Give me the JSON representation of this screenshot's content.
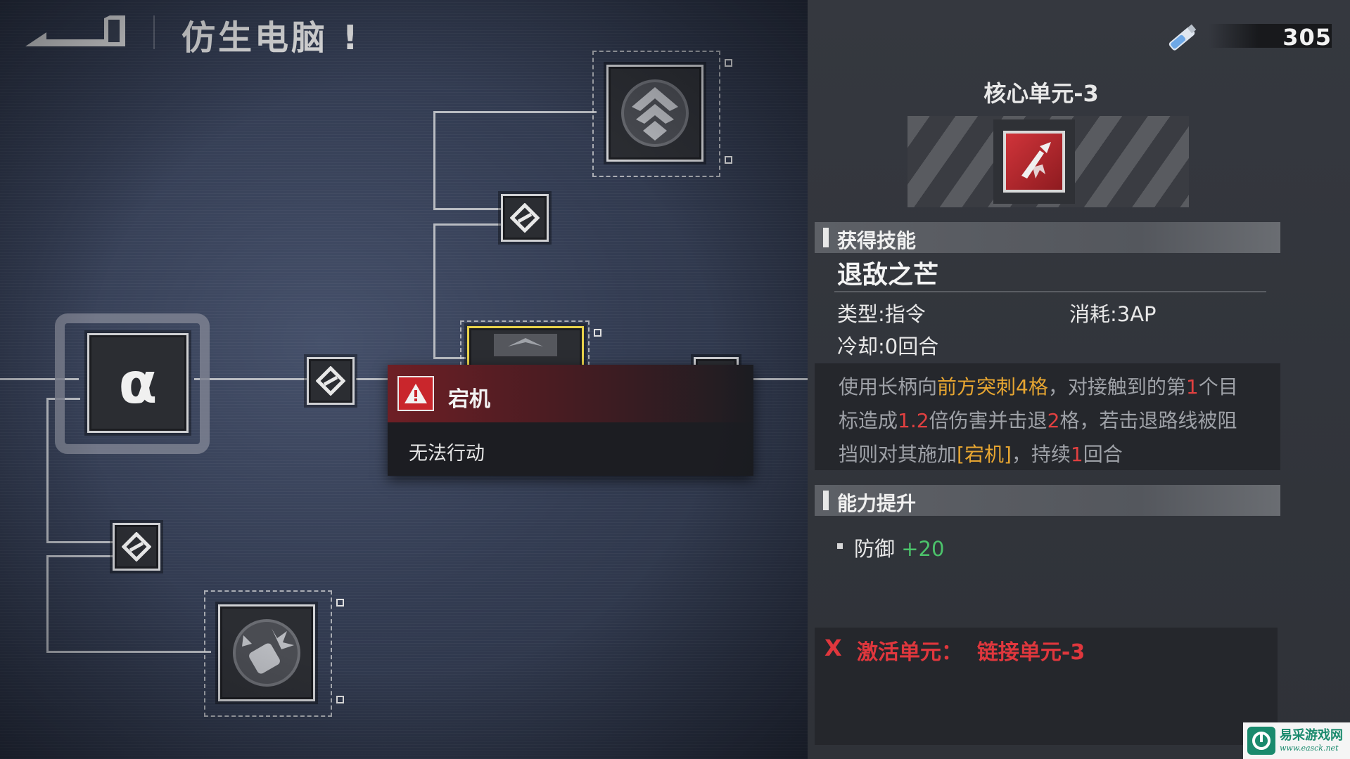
{
  "header": {
    "page_title": "仿生电脑 !"
  },
  "tree": {
    "core_node_symbol": "α"
  },
  "tooltip": {
    "title": "宕机",
    "description": "无法行动"
  },
  "currency": {
    "value": "305"
  },
  "unit": {
    "title": "核心单元-3"
  },
  "skill_section": {
    "heading": "获得技能",
    "skill_name": "退敌之芒",
    "type_label": "类型:指令",
    "cost_label": "消耗:3AP",
    "cooldown_label": "冷却:0回合",
    "description": {
      "l1_a": "使用长柄向",
      "l1_b": "前方突刺4格",
      "l1_c": "，对接触到的第",
      "l1_d": "1",
      "l1_e": "个目",
      "l2_a": "标造成",
      "l2_b": "1.2",
      "l2_c": "倍伤害并击退",
      "l2_d": "2",
      "l2_e": "格，若击退路线被阻",
      "l3_a": "挡则对其施加",
      "l3_b": "[宕机]",
      "l3_c": "，持续",
      "l3_d": "1",
      "l3_e": "回合"
    }
  },
  "ability_section": {
    "heading": "能力提升",
    "stat_name": "防御",
    "stat_value": "+20"
  },
  "activate": {
    "x_mark": "X",
    "text": "激活单元：  链接单元-3"
  },
  "watermark": {
    "name": "易采游戏网",
    "url": "www.easck.net"
  },
  "colors": {
    "accent_red": "#e0373d",
    "highlight_yellow": "#e6a531",
    "positive_green": "#4cc36b",
    "selected_node_border": "#e8d24a"
  }
}
